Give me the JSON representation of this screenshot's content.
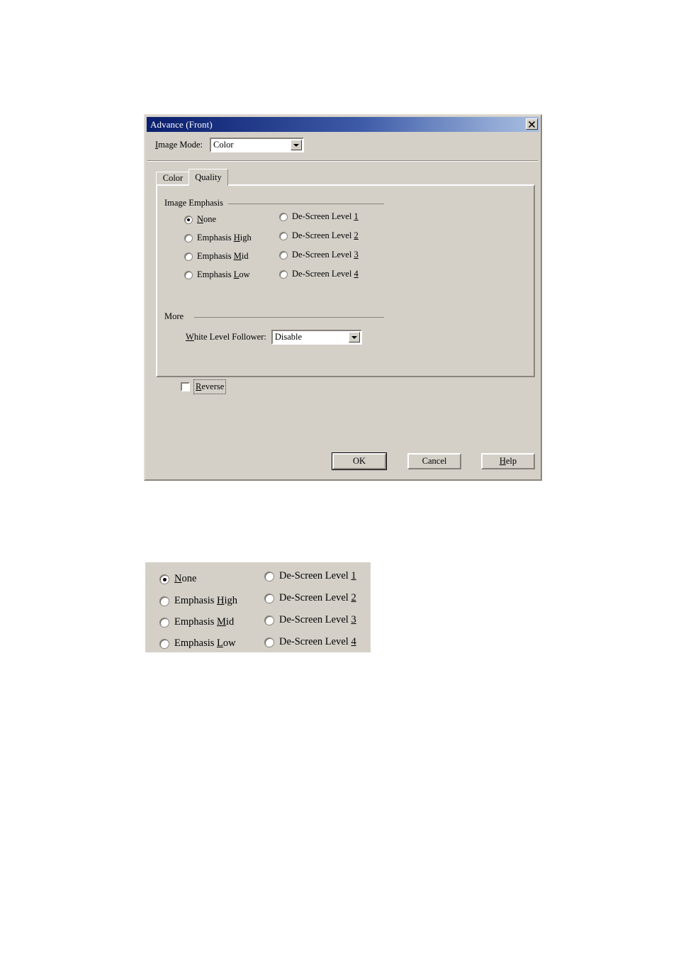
{
  "dialog": {
    "title": "Advance  (Front)",
    "close_icon": "close-icon",
    "image_mode": {
      "label": "Image Mode:",
      "label_accel": "I",
      "value": "Color"
    },
    "tabs": [
      {
        "label": "Color",
        "selected": false
      },
      {
        "label": "Quality",
        "selected": true
      }
    ],
    "groups": {
      "image_emphasis": {
        "caption": "Image Emphasis",
        "left_column": [
          {
            "label": "None",
            "accel": "N",
            "checked": true
          },
          {
            "label": "Emphasis High",
            "accel": "H",
            "checked": false
          },
          {
            "label": "Emphasis Mid",
            "accel": "M",
            "checked": false
          },
          {
            "label": "Emphasis Low",
            "accel": "L",
            "checked": false
          }
        ],
        "right_column": [
          {
            "label": "De-Screen Level 1",
            "accel": "1",
            "checked": false
          },
          {
            "label": "De-Screen Level 2",
            "accel": "2",
            "checked": false
          },
          {
            "label": "De-Screen Level 3",
            "accel": "3",
            "checked": false
          },
          {
            "label": "De-Screen Level 4",
            "accel": "4",
            "checked": false
          }
        ]
      },
      "more": {
        "caption": "More",
        "white_level_follower": {
          "label": "White Level Follower:",
          "label_accel": "W",
          "value": "Disable"
        },
        "reverse": {
          "label": "Reverse",
          "accel": "R",
          "checked": false,
          "focused": true
        }
      }
    },
    "buttons": {
      "ok": "OK",
      "cancel": "Cancel",
      "help": "Help",
      "help_accel": "H"
    }
  },
  "figure2": {
    "left_column": [
      {
        "label": "None",
        "accel": "N",
        "checked": true
      },
      {
        "label": "Emphasis High",
        "accel": "H",
        "checked": false
      },
      {
        "label": "Emphasis Mid",
        "accel": "M",
        "checked": false
      },
      {
        "label": "Emphasis Low",
        "accel": "L",
        "checked": false
      }
    ],
    "right_column": [
      {
        "label": "De-Screen Level 1",
        "accel": "1",
        "checked": false
      },
      {
        "label": "De-Screen Level 2",
        "accel": "2",
        "checked": false
      },
      {
        "label": "De-Screen Level 3",
        "accel": "3",
        "checked": false
      },
      {
        "label": "De-Screen Level 4",
        "accel": "4",
        "checked": false
      }
    ]
  },
  "colors": {
    "face": "#d4d0c8",
    "title_start": "#0a1f6e",
    "title_end": "#a8bde0",
    "shadow": "#8a857c"
  }
}
